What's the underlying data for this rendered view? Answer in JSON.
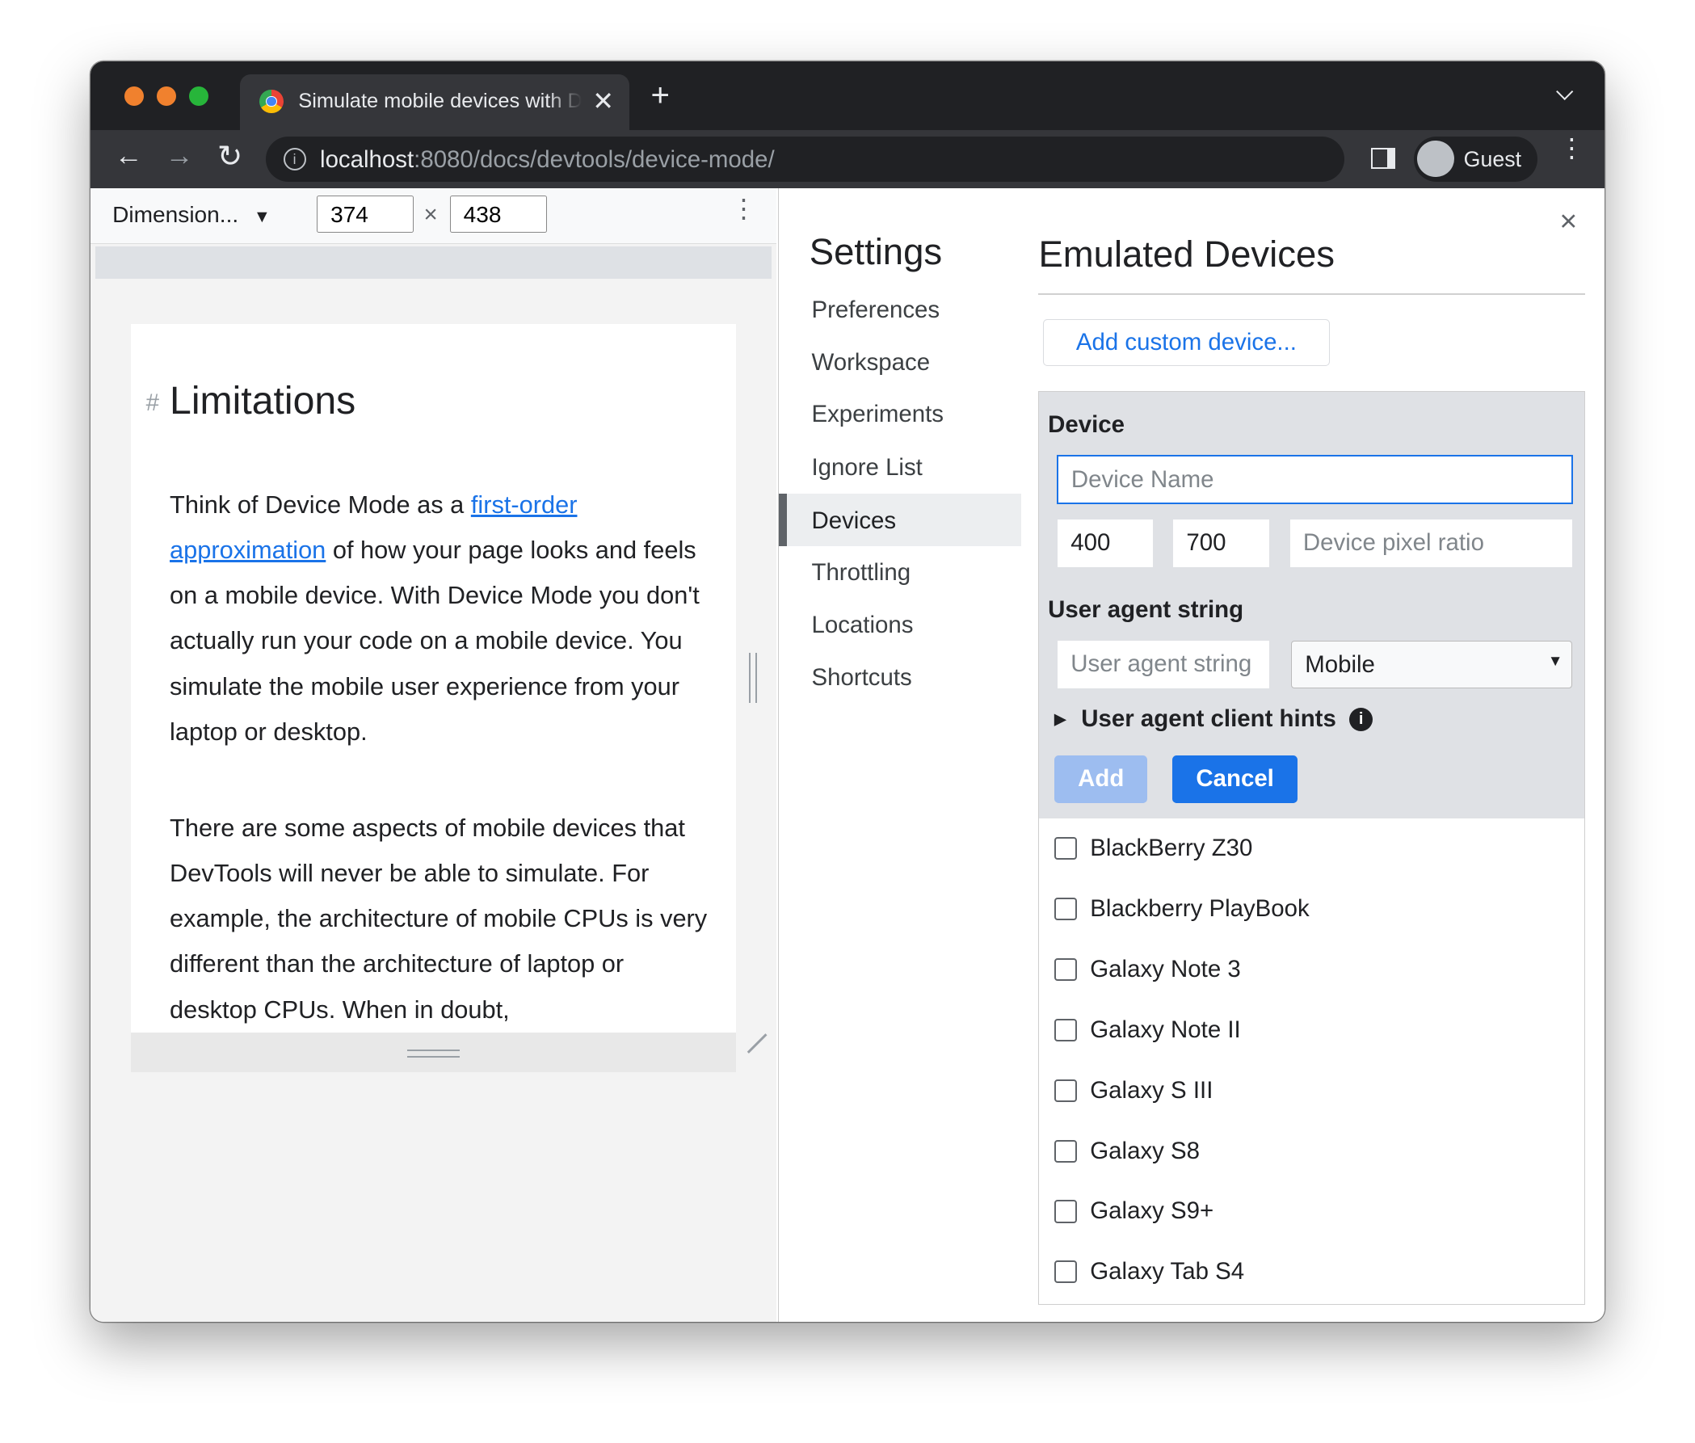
{
  "browser": {
    "tab_title": "Simulate mobile devices with Device Mode",
    "url_host": "localhost",
    "url_path": ":8080/docs/devtools/device-mode/",
    "profile_label": "Guest",
    "traffic_lights": [
      "#f0812e",
      "#f0812e",
      "#27b53a"
    ]
  },
  "device_toolbar": {
    "preset": "Dimension...",
    "width": "374",
    "height": "438",
    "times": "×"
  },
  "page": {
    "heading_anchor": "#",
    "heading": "Limitations",
    "p1_before": "Think of Device Mode as a ",
    "p1_link": "first-order approximation",
    "p1_after": " of how your page looks and feels on a mobile device. With Device Mode you don't actually run your code on a mobile device. You simulate the mobile user experience from your laptop or desktop.",
    "p2": "There are some aspects of mobile devices that DevTools will never be able to simulate. For example, the architecture of mobile CPUs is very different than the architecture of laptop or desktop CPUs. When in doubt,"
  },
  "settings": {
    "title": "Settings",
    "menu": [
      "Preferences",
      "Workspace",
      "Experiments",
      "Ignore List",
      "Devices",
      "Throttling",
      "Locations",
      "Shortcuts"
    ],
    "selected": "Devices",
    "close": "×"
  },
  "devices": {
    "title": "Emulated Devices",
    "add_custom": "Add custom device...",
    "device_label": "Device",
    "name_placeholder": "Device Name",
    "width_value": "400",
    "height_value": "700",
    "dpr_placeholder": "Device pixel ratio",
    "ua_label": "User agent string",
    "ua_placeholder": "User agent string",
    "ua_type": "Mobile",
    "client_hints": "User agent client hints",
    "add": "Add",
    "cancel": "Cancel",
    "list": [
      "BlackBerry Z30",
      "Blackberry PlayBook",
      "Galaxy Note 3",
      "Galaxy Note II",
      "Galaxy S III",
      "Galaxy S8",
      "Galaxy S9+",
      "Galaxy Tab S4"
    ],
    "accent": "#1a73e8"
  }
}
